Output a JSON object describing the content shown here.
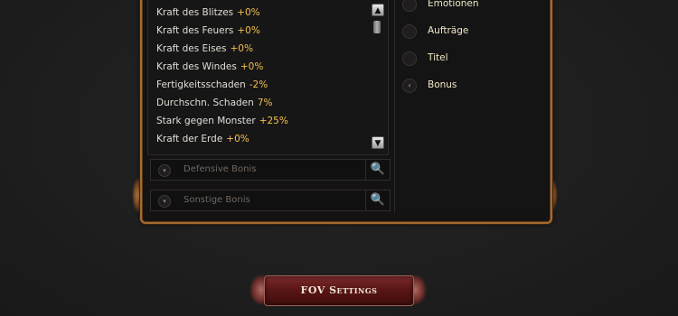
{
  "stats": [
    {
      "label": "Kraft des Blitzes",
      "value": "+0%"
    },
    {
      "label": "Kraft des Feuers",
      "value": "+0%"
    },
    {
      "label": "Kraft des Eises",
      "value": "+0%"
    },
    {
      "label": "Kraft des Windes",
      "value": "+0%"
    },
    {
      "label": "Fertigkeitsschaden",
      "value": "-2%"
    },
    {
      "label": "Durchschn. Schaden",
      "value": "7%"
    },
    {
      "label": "Stark gegen Monster",
      "value": "+25%"
    },
    {
      "label": "Kraft der Erde",
      "value": "+0%"
    }
  ],
  "scrollbar": {
    "up_glyph": "▲",
    "down_glyph": "▼"
  },
  "categories": {
    "defensive": {
      "label": "Defensive Bonis",
      "toggle_glyph": "▾",
      "icon": "search-icon",
      "icon_glyph": "🔍"
    },
    "other": {
      "label": "Sonstige Bonis",
      "toggle_glyph": "▾",
      "icon": "search-icon",
      "icon_glyph": "🔍"
    }
  },
  "menu": [
    {
      "label": "Emotionen",
      "glyph": ""
    },
    {
      "label": "Aufträge",
      "glyph": ""
    },
    {
      "label": "Titel",
      "glyph": ""
    },
    {
      "label": "Bonus",
      "glyph": "‹"
    }
  ],
  "fov_button": {
    "label": "FOV Settings"
  },
  "colors": {
    "frame_border": "#a66a2e",
    "stat_value": "#f2c04f",
    "menu_text": "#f0e7c8",
    "button_red": "#5a1616"
  }
}
